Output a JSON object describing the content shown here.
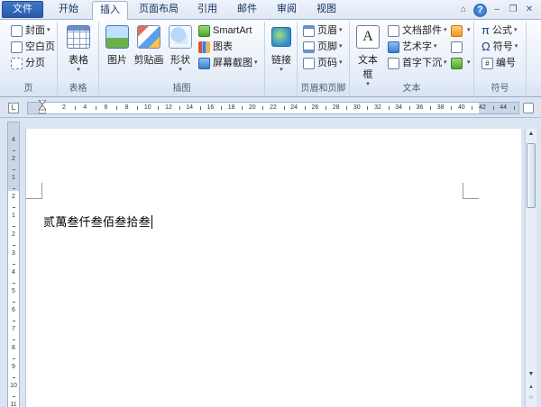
{
  "tabs": [
    {
      "label": "文件"
    },
    {
      "label": "开始"
    },
    {
      "label": "插入"
    },
    {
      "label": "页面布局"
    },
    {
      "label": "引用"
    },
    {
      "label": "邮件"
    },
    {
      "label": "审阅"
    },
    {
      "label": "视图"
    }
  ],
  "active_tab": "插入",
  "window_controls": {
    "collapse": "⌂",
    "help": "?",
    "minimize": "–",
    "restore": "❐",
    "close": "✕"
  },
  "ribbon": {
    "pages": {
      "label": "页",
      "cover": "封面",
      "blank": "空白页",
      "break": "分页"
    },
    "tables": {
      "label": "表格",
      "table": "表格"
    },
    "illustrations": {
      "label": "插图",
      "picture": "图片",
      "clipart": "剪贴画",
      "shapes": "形状",
      "smartart": "SmartArt",
      "chart": "图表",
      "screenshot": "屏幕截图"
    },
    "links": {
      "label": "",
      "link": "链接"
    },
    "header_footer": {
      "label": "页眉和页脚",
      "header": "页眉",
      "footer": "页脚",
      "page_number": "页码"
    },
    "text": {
      "label": "文本",
      "textbox": "文本框",
      "quick_parts": "文档部件",
      "wordart": "艺术字",
      "dropcap": "首字下沉"
    },
    "symbols": {
      "label": "符号",
      "equation": "公式",
      "symbol": "符号",
      "numbering": "编号"
    }
  },
  "ruler": {
    "selector": "L",
    "h_ticks": [
      "2",
      "4",
      "6",
      "8",
      "10",
      "12",
      "14",
      "16",
      "18",
      "20",
      "22",
      "24",
      "26",
      "28",
      "30",
      "32",
      "34",
      "36",
      "38",
      "40",
      "42",
      "44"
    ],
    "v_ticks": [
      "4",
      "2",
      "1",
      "2",
      "1",
      "2",
      "3",
      "4",
      "5",
      "6",
      "7",
      "8",
      "9",
      "10",
      "11"
    ]
  },
  "document": {
    "text": "贰萬叁仟叁佰叁拾叁"
  },
  "colors": {
    "file_tab": "#2a5aa9",
    "ribbon_bg": "#e4ecf7",
    "workspace": "#dbe5f1"
  }
}
